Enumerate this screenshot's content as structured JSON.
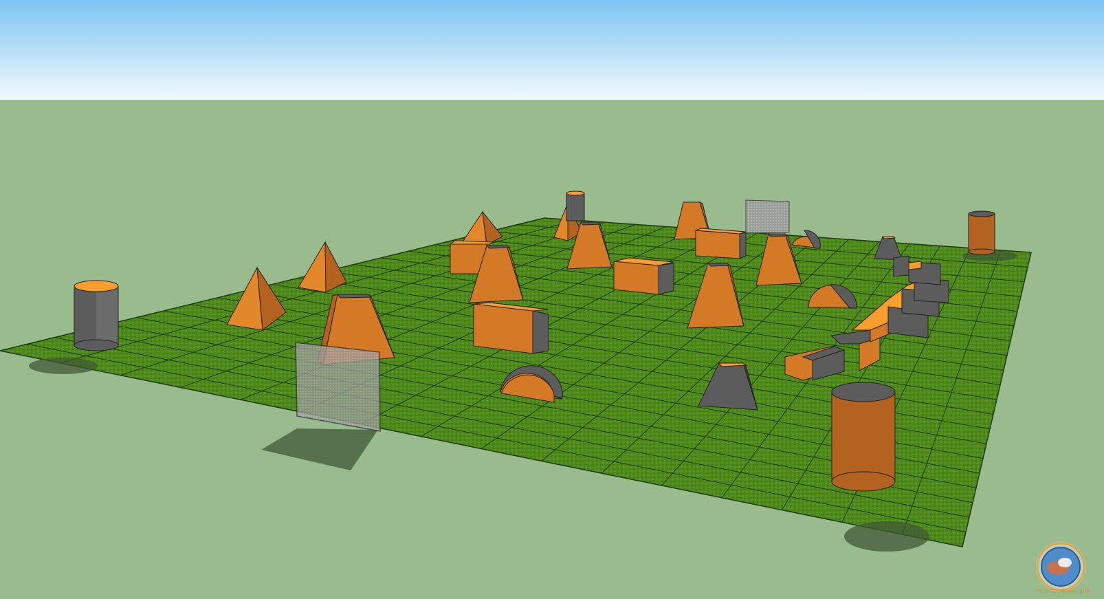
{
  "scene": {
    "description_label": "",
    "colors": {
      "sky_top": "#7cc4f2",
      "sky_bottom": "#eef6fb",
      "ground": "#98bc8e",
      "field_grass": "#4f8a1c",
      "grid_line": "#1f3a0e",
      "obstacle_orange": "#ff9d2e",
      "obstacle_orange_dark": "#b3621f",
      "obstacle_orange_mid": "#d47a26",
      "obstacle_gray": "#5c5c5c",
      "obstacle_gray_dark": "#3f3f3f",
      "glass_panel": "#b7b7b7",
      "shadow": "#3f5a36"
    },
    "watermark": {
      "icon": "globe-seal-icon",
      "text": "ПЕЙНТБОЛЬНАЯ ЛИГА"
    }
  }
}
